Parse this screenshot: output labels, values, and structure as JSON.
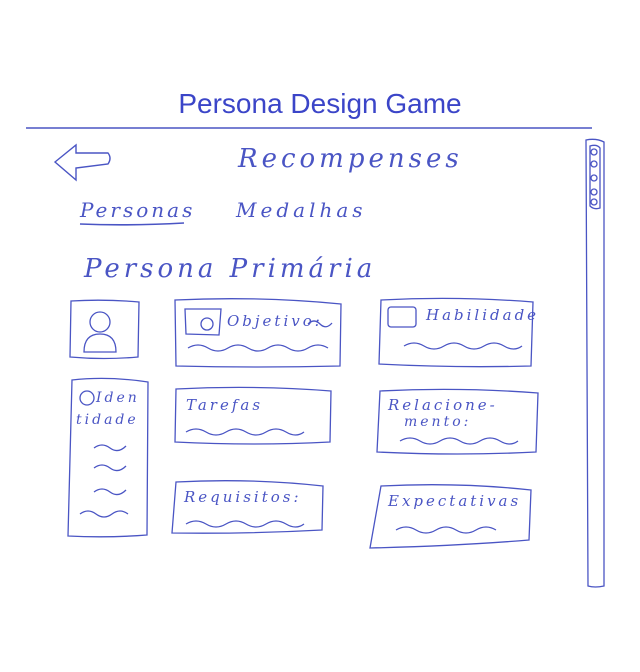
{
  "app": {
    "title": "Persona Design Game"
  },
  "nav": {
    "back_icon": "arrow-left-icon",
    "screen_title": "Recompenses"
  },
  "tabs": [
    {
      "label": "Personas",
      "active": true
    },
    {
      "label": "Medalhas",
      "active": false
    }
  ],
  "section": {
    "title": "Persona Primária"
  },
  "cards": {
    "avatar_icon": "person-icon",
    "objetivo": "Objetivo:",
    "habilidades": "Habilidade",
    "identidade_1": "Iden",
    "identidade_2": "tidade",
    "tarefas": "Tarefas",
    "relacionamento_1": "Relacione-",
    "relacionamento_2": "mento:",
    "requisitos": "Requisitos:",
    "expectativas": "Expectativas"
  },
  "colors": {
    "ink": "#3b45c8",
    "line": "#6470d0"
  }
}
